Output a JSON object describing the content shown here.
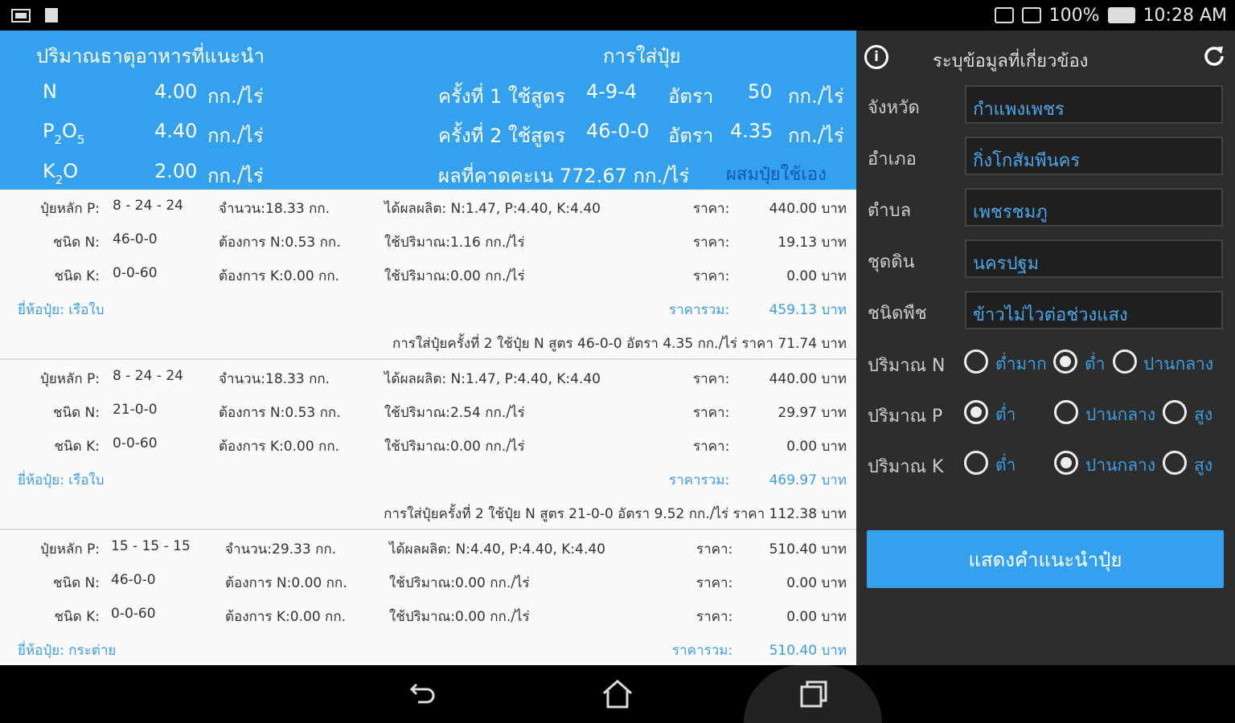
{
  "status_bar": {
    "battery": "100%",
    "time": "10:28 AM"
  },
  "summary": {
    "left_title": "ปริมาณธาตุอาหารที่แนะนำ",
    "nutrients": [
      {
        "name": "N",
        "name_sub": "",
        "name_mid": "",
        "name_sub2": "",
        "value": "4.00",
        "unit": "กก./ไร่"
      },
      {
        "name": "P",
        "name_sub": "2",
        "name_mid": "O",
        "name_sub2": "5",
        "value": "4.40",
        "unit": "กก./ไร่"
      },
      {
        "name": "K",
        "name_sub": "2",
        "name_mid": "O",
        "name_sub2": "",
        "value": "2.00",
        "unit": "กก./ไร่"
      }
    ],
    "right_title": "การใส่ปุ๋ย",
    "rounds": [
      {
        "label": "ครั้งที่ 1 ใช้สูตร",
        "formula": "4-9-4",
        "rate_label": "อัตรา",
        "rate": "50",
        "unit": "กก./ไร่"
      },
      {
        "label": "ครั้งที่ 2 ใช้สูตร",
        "formula": "46-0-0",
        "rate_label": "อัตรา",
        "rate": "4.35",
        "unit": "กก./ไร่"
      }
    ],
    "yield_text": "ผลที่คาดคะเน 772.67 กก./ไร่",
    "mix_link": "ผสมปุ๋ยใช้เอง"
  },
  "groups": [
    {
      "rows": [
        {
          "label": "ปุ๋ยหลัก P:",
          "formula": "8 - 24 - 24",
          "amount": "จำนวน:18.33 กก.",
          "info": "ได้ผลผลิต: N:1.47, P:4.40, K:4.40",
          "price_label": "ราคา:",
          "price": "440.00 บาท"
        },
        {
          "label": "ชนิด N:",
          "formula": "46-0-0",
          "amount": "ต้องการ N:0.53 กก.",
          "info": "ใช้ปริมาณ:1.16 กก./ไร่",
          "price_label": "ราคา:",
          "price": "19.13 บาท"
        },
        {
          "label": "ชนิด K:",
          "formula": "0-0-60",
          "amount": "ต้องการ K:0.00 กก.",
          "info": "ใช้ปริมาณ:0.00 กก./ไร่",
          "price_label": "ราคา:",
          "price": "0.00 บาท"
        }
      ],
      "brand": "ยี่ห้อปุ๋ย: เรือใบ",
      "total_label": "ราคารวม:",
      "total": "459.13 บาท",
      "note": "การใส่ปุ๋ยครั้งที่ 2 ใช้ปุ๋ย N   สูตร 46-0-0   อัตรา 4.35 กก./ไร่   ราคา 71.74 บาท"
    },
    {
      "rows": [
        {
          "label": "ปุ๋ยหลัก P:",
          "formula": "8 - 24 - 24",
          "amount": "จำนวน:18.33 กก.",
          "info": "ได้ผลผลิต: N:1.47, P:4.40, K:4.40",
          "price_label": "ราคา:",
          "price": "440.00 บาท"
        },
        {
          "label": "ชนิด N:",
          "formula": "21-0-0",
          "amount": "ต้องการ N:0.53 กก.",
          "info": "ใช้ปริมาณ:2.54 กก./ไร่",
          "price_label": "ราคา:",
          "price": "29.97 บาท"
        },
        {
          "label": "ชนิด K:",
          "formula": "0-0-60",
          "amount": "ต้องการ K:0.00 กก.",
          "info": "ใช้ปริมาณ:0.00 กก./ไร่",
          "price_label": "ราคา:",
          "price": "0.00 บาท"
        }
      ],
      "brand": "ยี่ห้อปุ๋ย: เรือใบ",
      "total_label": "ราคารวม:",
      "total": "469.97 บาท",
      "note": "การใส่ปุ๋ยครั้งที่ 2 ใช้ปุ๋ย N   สูตร 21-0-0   อัตรา 9.52 กก./ไร่   ราคา 112.38 บาท"
    },
    {
      "rows": [
        {
          "label": "ปุ๋ยหลัก P:",
          "formula": "15 - 15 - 15",
          "amount": "จำนวน:29.33 กก.",
          "info": "ได้ผลผลิต: N:4.40, P:4.40, K:4.40",
          "price_label": "ราคา:",
          "price": "510.40 บาท"
        },
        {
          "label": "ชนิด N:",
          "formula": "46-0-0",
          "amount": "ต้องการ N:0.00 กก.",
          "info": "ใช้ปริมาณ:0.00 กก./ไร่",
          "price_label": "ราคา:",
          "price": "0.00 บาท"
        },
        {
          "label": "ชนิด K:",
          "formula": "0-0-60",
          "amount": "ต้องการ K:0.00 กก.",
          "info": "ใช้ปริมาณ:0.00 กก./ไร่",
          "price_label": "ราคา:",
          "price": "0.00 บาท"
        }
      ],
      "brand": "ยี่ห้อปุ๋ย: กระต่าย",
      "total_label": "ราคารวม:",
      "total": "510.40 บาท",
      "note": ""
    }
  ],
  "side": {
    "title": "ระบุข้อมูลที่เกี่ยวข้อง",
    "fields": [
      {
        "label": "จังหวัด",
        "value": "กำแพงเพชร"
      },
      {
        "label": "อำเภอ",
        "value": "กิ่งโกสัมพีนคร"
      },
      {
        "label": "ตำบล",
        "value": "เพชรชมภู"
      },
      {
        "label": "ชุดดิน",
        "value": "นครปฐม"
      },
      {
        "label": "ชนิดพืช",
        "value": "ข้าวไม่ไวต่อช่วงแสง"
      }
    ],
    "radios": [
      {
        "label": "ปริมาณ N",
        "options": [
          "ต่ำมาก",
          "ต่ำ",
          "ปานกลาง"
        ],
        "selected": 1
      },
      {
        "label": "ปริมาณ P",
        "options": [
          "ต่ำ",
          "ปานกลาง",
          "สูง"
        ],
        "selected": 0
      },
      {
        "label": "ปริมาณ K",
        "options": [
          "ต่ำ",
          "ปานกลาง",
          "สูง"
        ],
        "selected": 1
      }
    ],
    "button": "แสดงคำแนะนำปุ๋ย"
  },
  "icons": {
    "info": "info-icon",
    "refresh": "refresh-icon",
    "back": "back-icon",
    "home": "home-icon",
    "recents": "recents-icon"
  },
  "colors": {
    "accent": "#33a1ee",
    "link": "#3a9ee4",
    "panel_dark": "#2d2d2d"
  }
}
